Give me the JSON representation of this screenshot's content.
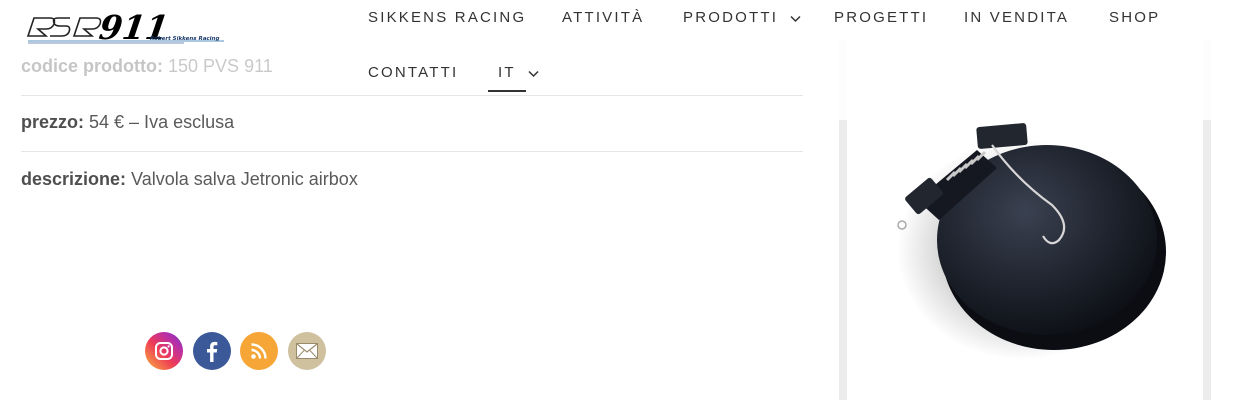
{
  "header": {
    "logo_text": "RSR911",
    "logo_subtitle": "Robert Sikkens Racing",
    "nav": [
      {
        "label": "SIKKENS RACING"
      },
      {
        "label": "ATTIVITÀ"
      },
      {
        "label": "PRODOTTI"
      },
      {
        "label": "PROGETTI"
      },
      {
        "label": "IN VENDITA"
      },
      {
        "label": "SHOP"
      },
      {
        "label": "CONTATTI"
      },
      {
        "label": "IT"
      }
    ]
  },
  "product": {
    "code_label": "codice prodotto:",
    "code_value": "150 PVS 911",
    "price_label": "prezzo:",
    "price_value": "54 € – Iva esclusa",
    "description_label": "descrizione:",
    "description_value": "Valvola salva Jetronic airbox"
  },
  "social": {
    "icons": [
      "instagram-icon",
      "facebook-icon",
      "rss-icon",
      "email-icon"
    ]
  },
  "colors": {
    "instagram": "#e1306c",
    "facebook": "#3b5998",
    "rss": "#f5a636",
    "email": "#cfc19e"
  }
}
